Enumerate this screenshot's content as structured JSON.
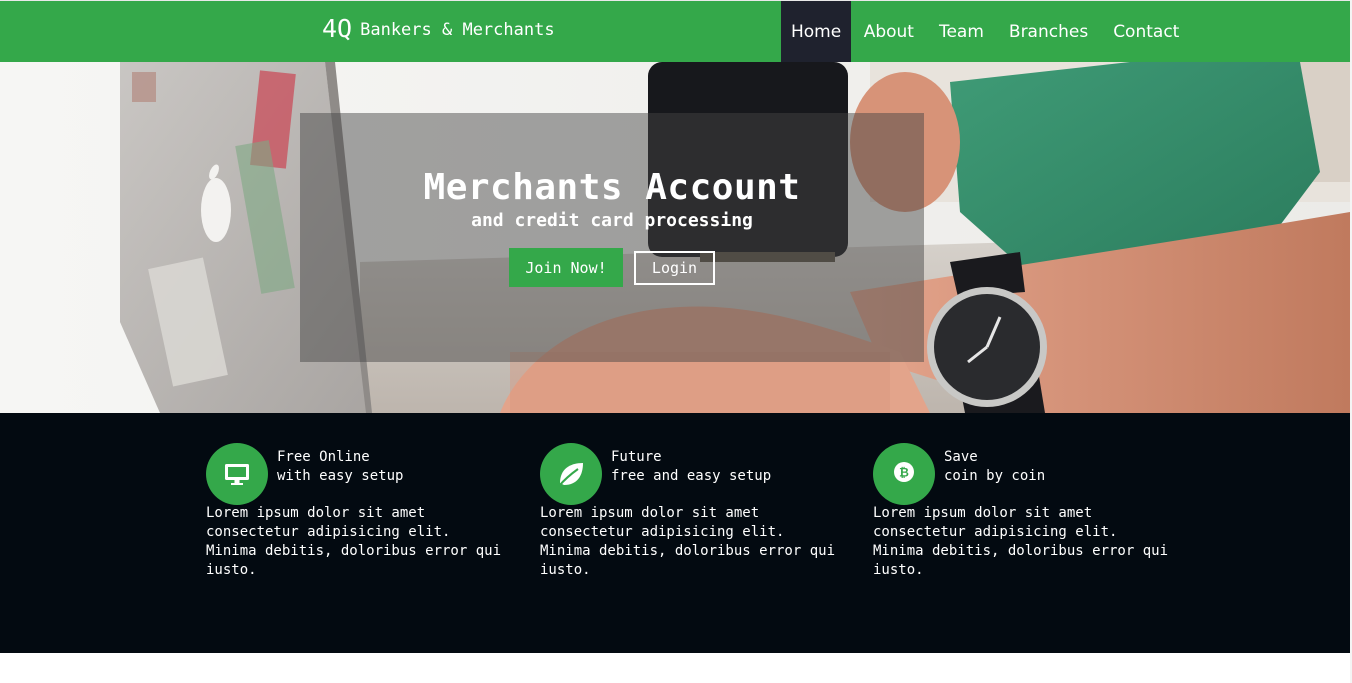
{
  "brand": {
    "mark": "4Q",
    "name": "Bankers & Merchants"
  },
  "nav": {
    "items": [
      {
        "label": "Home",
        "active": true
      },
      {
        "label": "About"
      },
      {
        "label": "Team"
      },
      {
        "label": "Branches"
      },
      {
        "label": "Contact"
      }
    ]
  },
  "hero": {
    "title": "Merchants Account",
    "subtitle": "and credit card processing",
    "primary_button": "Join Now!",
    "secondary_button": "Login"
  },
  "features": [
    {
      "icon": "monitor-icon",
      "title": "Free Online",
      "subtitle": "with easy setup",
      "body": "Lorem ipsum dolor sit amet consectetur adipisicing elit. Minima debitis, doloribus error qui iusto."
    },
    {
      "icon": "leaf-icon",
      "title": "Future",
      "subtitle": "free and easy setup",
      "body": "Lorem ipsum dolor sit amet consectetur adipisicing elit. Minima debitis, doloribus error qui iusto."
    },
    {
      "icon": "bitcoin-icon",
      "title": "Save",
      "subtitle": "coin by coin",
      "body": "Lorem ipsum dolor sit amet consectetur adipisicing elit. Minima debitis, doloribus error qui iusto."
    }
  ],
  "colors": {
    "accent": "#34a84a",
    "nav_active": "#1f222e",
    "features_bg": "#030a11"
  }
}
